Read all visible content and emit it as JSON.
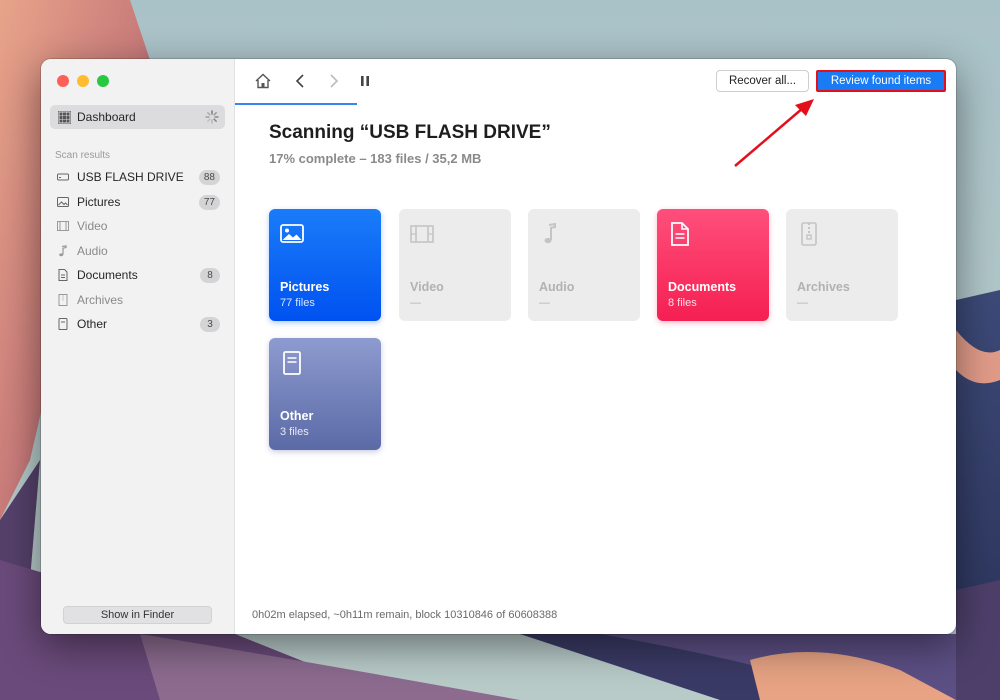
{
  "sidebar": {
    "dashboard_label": "Dashboard",
    "section_title": "Scan results",
    "items": [
      {
        "label": "USB FLASH DRIVE",
        "badge": "88"
      },
      {
        "label": "Pictures",
        "badge": "77"
      },
      {
        "label": "Video",
        "badge": ""
      },
      {
        "label": "Audio",
        "badge": ""
      },
      {
        "label": "Documents",
        "badge": "8"
      },
      {
        "label": "Archives",
        "badge": ""
      },
      {
        "label": "Other",
        "badge": "3"
      }
    ],
    "finder_button": "Show in Finder"
  },
  "toolbar": {
    "recover_label": "Recover all...",
    "review_label": "Review found items"
  },
  "main": {
    "title": "Scanning “USB FLASH DRIVE”",
    "subtitle": "17% complete – 183 files / 35,2 MB",
    "progress_fraction": 0.17,
    "tiles": [
      {
        "name": "Pictures",
        "count": "77 files",
        "icon": "picture-icon",
        "color": "#0a63f5"
      },
      {
        "name": "Video",
        "count": "—",
        "icon": "film-icon",
        "color": "#ececec"
      },
      {
        "name": "Audio",
        "count": "—",
        "icon": "music-note-icon",
        "color": "#ececec"
      },
      {
        "name": "Documents",
        "count": "8 files",
        "icon": "document-icon",
        "color": "#fa2d5f"
      },
      {
        "name": "Archives",
        "count": "—",
        "icon": "archive-icon",
        "color": "#ececec"
      },
      {
        "name": "Other",
        "count": "3 files",
        "icon": "file-icon",
        "color": "#7482be"
      }
    ],
    "status": "0h02m elapsed, ~0h11m remain, block 10310846 of 60608388"
  },
  "colors": {
    "accent": "#1a7cf5",
    "highlight_border": "#e3101c"
  }
}
